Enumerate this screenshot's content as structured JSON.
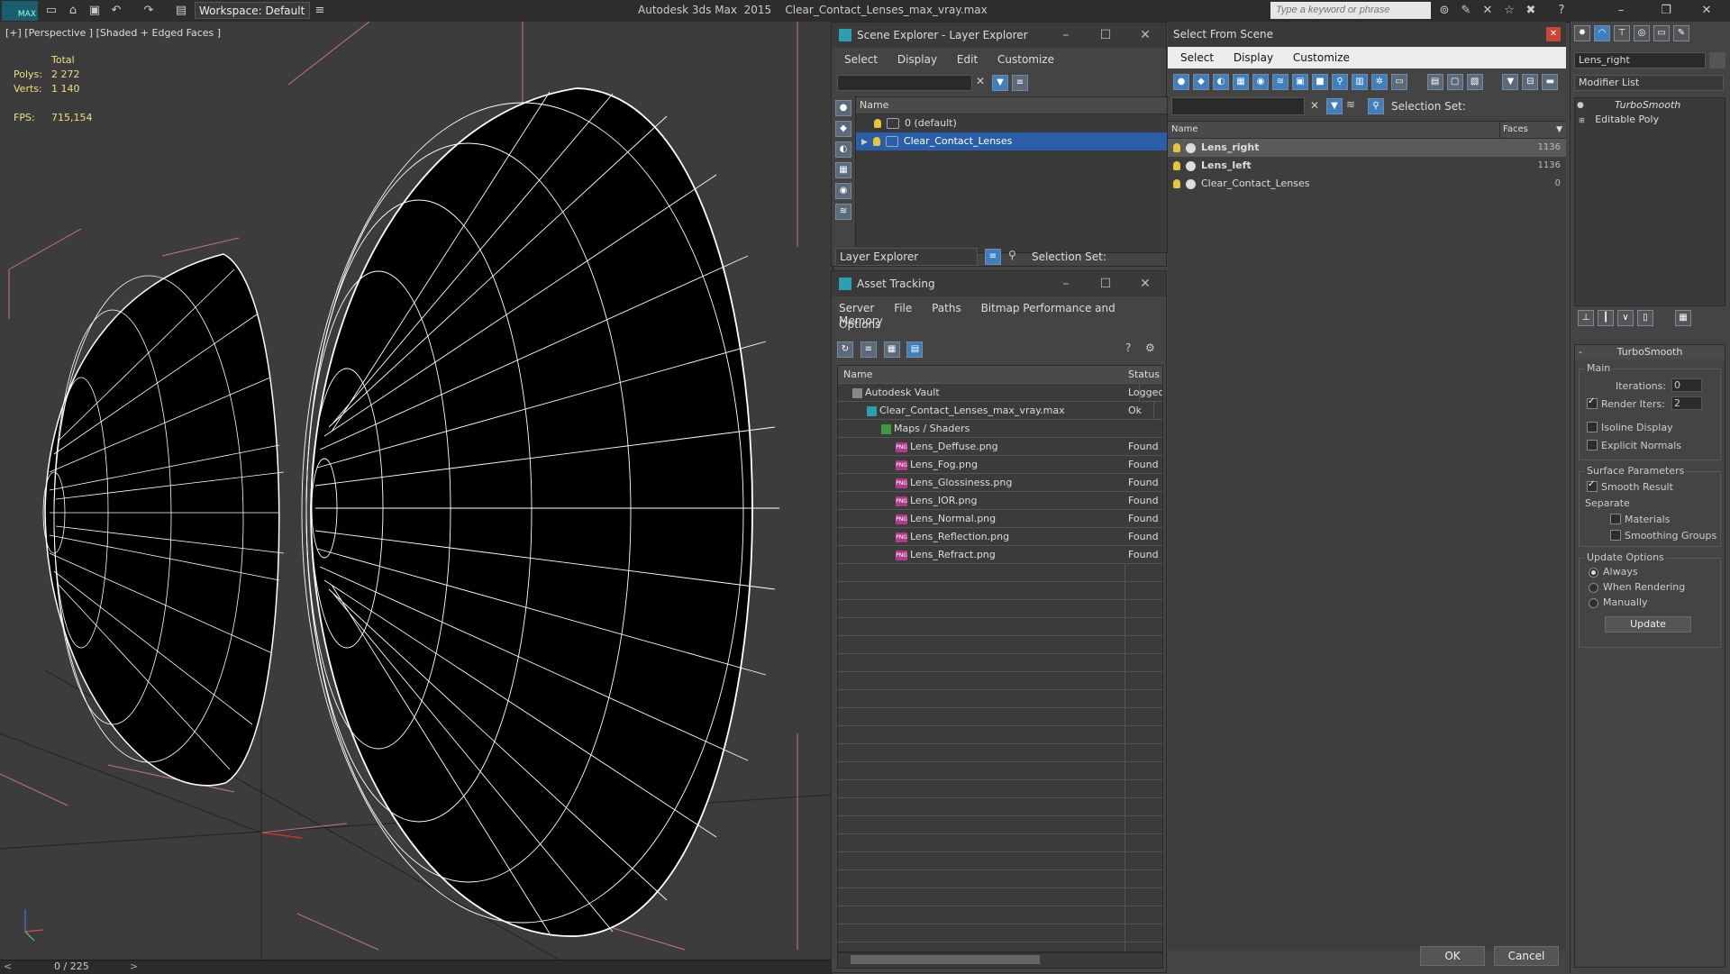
{
  "titlebar": {
    "app_logo": "MAX",
    "workspace": "Workspace: Default",
    "title": "Autodesk 3ds Max  2015    Clear_Contact_Lenses_max_vray.max",
    "search_placeholder": "Type a keyword or phrase"
  },
  "viewport": {
    "label": "[+] [Perspective ] [Shaded + Edged Faces ]",
    "stats": {
      "total_label": "Total",
      "polys_label": "Polys:",
      "polys_value": "2 272",
      "verts_label": "Verts:",
      "verts_value": "1 140",
      "fps_label": "FPS:",
      "fps_value": "715,154"
    },
    "time": "0 / 225"
  },
  "scene_explorer": {
    "title": "Scene Explorer - Layer Explorer",
    "menu": [
      "Select",
      "Display",
      "Edit",
      "Customize"
    ],
    "column": "Name",
    "rows": [
      {
        "name": "0 (default)",
        "selected": false
      },
      {
        "name": "Clear_Contact_Lenses",
        "selected": true
      }
    ],
    "footer_dropdown": "Layer Explorer",
    "selection_set_label": "Selection Set:"
  },
  "asset_tracking": {
    "title": "Asset Tracking",
    "menu1": [
      "Server",
      "File",
      "Paths",
      "Bitmap Performance and Memory"
    ],
    "menu2": [
      "Options"
    ],
    "columns": [
      "Name",
      "Status"
    ],
    "rows": [
      {
        "name": "Autodesk Vault",
        "status": "Logged",
        "indent": 1,
        "kind": "vault"
      },
      {
        "name": "Clear_Contact_Lenses_max_vray.max",
        "status": "Ok",
        "indent": 2,
        "kind": "max"
      },
      {
        "name": "Maps / Shaders",
        "status": "",
        "indent": 3,
        "kind": "maps"
      },
      {
        "name": "Lens_Deffuse.png",
        "status": "Found",
        "indent": 4,
        "kind": "png"
      },
      {
        "name": "Lens_Fog.png",
        "status": "Found",
        "indent": 4,
        "kind": "png"
      },
      {
        "name": "Lens_Glossiness.png",
        "status": "Found",
        "indent": 4,
        "kind": "png"
      },
      {
        "name": "Lens_IOR.png",
        "status": "Found",
        "indent": 4,
        "kind": "png"
      },
      {
        "name": "Lens_Normal.png",
        "status": "Found",
        "indent": 4,
        "kind": "png"
      },
      {
        "name": "Lens_Reflection.png",
        "status": "Found",
        "indent": 4,
        "kind": "png"
      },
      {
        "name": "Lens_Refract.png",
        "status": "Found",
        "indent": 4,
        "kind": "png"
      }
    ],
    "png_icon_text": "PNG"
  },
  "select_from_scene": {
    "title": "Select From Scene",
    "menu": [
      "Select",
      "Display",
      "Customize"
    ],
    "selection_set_label": "Selection Set:",
    "columns": [
      "Name",
      "Faces"
    ],
    "rows": [
      {
        "name": "Lens_right",
        "faces": "1136",
        "bold": true,
        "selected": true
      },
      {
        "name": "Lens_left",
        "faces": "1136",
        "bold": true,
        "selected": false
      },
      {
        "name": "Clear_Contact_Lenses",
        "faces": "0",
        "bold": false,
        "selected": false
      }
    ],
    "ok_label": "OK",
    "cancel_label": "Cancel"
  },
  "command_panel": {
    "object_name": "Lens_right",
    "modifier_list": "Modifier List",
    "stack": [
      "TurboSmooth",
      "Editable Poly"
    ],
    "rollout_title": "TurboSmooth",
    "main_group": "Main",
    "iterations_label": "Iterations:",
    "iterations_value": "0",
    "render_iters_label": "Render Iters:",
    "render_iters_value": "2",
    "render_iters_checked": true,
    "isoline_label": "Isoline Display",
    "explicit_normals_label": "Explicit Normals",
    "surface_group": "Surface Parameters",
    "smooth_result_label": "Smooth Result",
    "separate_label": "Separate",
    "materials_label": "Materials",
    "smoothing_groups_label": "Smoothing Groups",
    "update_group": "Update Options",
    "update_always": "Always",
    "update_when_rendering": "When Rendering",
    "update_manually": "Manually",
    "update_button": "Update"
  },
  "colors": {
    "selection_blue": "#2a5ea8",
    "stats_yellow": "#e8e080",
    "png_magenta": "#b03a8a"
  }
}
